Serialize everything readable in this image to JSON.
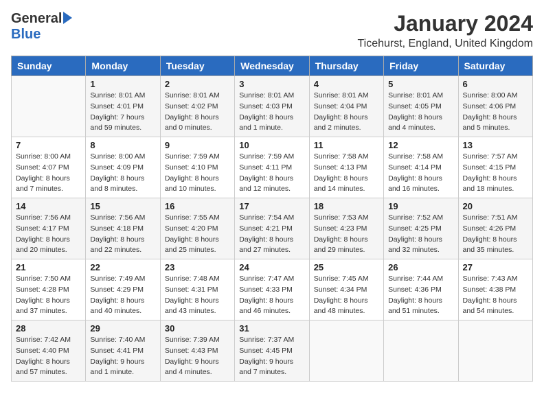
{
  "header": {
    "logo_general": "General",
    "logo_blue": "Blue",
    "month_title": "January 2024",
    "location": "Ticehurst, England, United Kingdom"
  },
  "days_of_week": [
    "Sunday",
    "Monday",
    "Tuesday",
    "Wednesday",
    "Thursday",
    "Friday",
    "Saturday"
  ],
  "weeks": [
    [
      {
        "day": "",
        "sunrise": "",
        "sunset": "",
        "daylight": ""
      },
      {
        "day": "1",
        "sunrise": "Sunrise: 8:01 AM",
        "sunset": "Sunset: 4:01 PM",
        "daylight": "Daylight: 7 hours and 59 minutes."
      },
      {
        "day": "2",
        "sunrise": "Sunrise: 8:01 AM",
        "sunset": "Sunset: 4:02 PM",
        "daylight": "Daylight: 8 hours and 0 minutes."
      },
      {
        "day": "3",
        "sunrise": "Sunrise: 8:01 AM",
        "sunset": "Sunset: 4:03 PM",
        "daylight": "Daylight: 8 hours and 1 minute."
      },
      {
        "day": "4",
        "sunrise": "Sunrise: 8:01 AM",
        "sunset": "Sunset: 4:04 PM",
        "daylight": "Daylight: 8 hours and 2 minutes."
      },
      {
        "day": "5",
        "sunrise": "Sunrise: 8:01 AM",
        "sunset": "Sunset: 4:05 PM",
        "daylight": "Daylight: 8 hours and 4 minutes."
      },
      {
        "day": "6",
        "sunrise": "Sunrise: 8:00 AM",
        "sunset": "Sunset: 4:06 PM",
        "daylight": "Daylight: 8 hours and 5 minutes."
      }
    ],
    [
      {
        "day": "7",
        "sunrise": "Sunrise: 8:00 AM",
        "sunset": "Sunset: 4:07 PM",
        "daylight": "Daylight: 8 hours and 7 minutes."
      },
      {
        "day": "8",
        "sunrise": "Sunrise: 8:00 AM",
        "sunset": "Sunset: 4:09 PM",
        "daylight": "Daylight: 8 hours and 8 minutes."
      },
      {
        "day": "9",
        "sunrise": "Sunrise: 7:59 AM",
        "sunset": "Sunset: 4:10 PM",
        "daylight": "Daylight: 8 hours and 10 minutes."
      },
      {
        "day": "10",
        "sunrise": "Sunrise: 7:59 AM",
        "sunset": "Sunset: 4:11 PM",
        "daylight": "Daylight: 8 hours and 12 minutes."
      },
      {
        "day": "11",
        "sunrise": "Sunrise: 7:58 AM",
        "sunset": "Sunset: 4:13 PM",
        "daylight": "Daylight: 8 hours and 14 minutes."
      },
      {
        "day": "12",
        "sunrise": "Sunrise: 7:58 AM",
        "sunset": "Sunset: 4:14 PM",
        "daylight": "Daylight: 8 hours and 16 minutes."
      },
      {
        "day": "13",
        "sunrise": "Sunrise: 7:57 AM",
        "sunset": "Sunset: 4:15 PM",
        "daylight": "Daylight: 8 hours and 18 minutes."
      }
    ],
    [
      {
        "day": "14",
        "sunrise": "Sunrise: 7:56 AM",
        "sunset": "Sunset: 4:17 PM",
        "daylight": "Daylight: 8 hours and 20 minutes."
      },
      {
        "day": "15",
        "sunrise": "Sunrise: 7:56 AM",
        "sunset": "Sunset: 4:18 PM",
        "daylight": "Daylight: 8 hours and 22 minutes."
      },
      {
        "day": "16",
        "sunrise": "Sunrise: 7:55 AM",
        "sunset": "Sunset: 4:20 PM",
        "daylight": "Daylight: 8 hours and 25 minutes."
      },
      {
        "day": "17",
        "sunrise": "Sunrise: 7:54 AM",
        "sunset": "Sunset: 4:21 PM",
        "daylight": "Daylight: 8 hours and 27 minutes."
      },
      {
        "day": "18",
        "sunrise": "Sunrise: 7:53 AM",
        "sunset": "Sunset: 4:23 PM",
        "daylight": "Daylight: 8 hours and 29 minutes."
      },
      {
        "day": "19",
        "sunrise": "Sunrise: 7:52 AM",
        "sunset": "Sunset: 4:25 PM",
        "daylight": "Daylight: 8 hours and 32 minutes."
      },
      {
        "day": "20",
        "sunrise": "Sunrise: 7:51 AM",
        "sunset": "Sunset: 4:26 PM",
        "daylight": "Daylight: 8 hours and 35 minutes."
      }
    ],
    [
      {
        "day": "21",
        "sunrise": "Sunrise: 7:50 AM",
        "sunset": "Sunset: 4:28 PM",
        "daylight": "Daylight: 8 hours and 37 minutes."
      },
      {
        "day": "22",
        "sunrise": "Sunrise: 7:49 AM",
        "sunset": "Sunset: 4:29 PM",
        "daylight": "Daylight: 8 hours and 40 minutes."
      },
      {
        "day": "23",
        "sunrise": "Sunrise: 7:48 AM",
        "sunset": "Sunset: 4:31 PM",
        "daylight": "Daylight: 8 hours and 43 minutes."
      },
      {
        "day": "24",
        "sunrise": "Sunrise: 7:47 AM",
        "sunset": "Sunset: 4:33 PM",
        "daylight": "Daylight: 8 hours and 46 minutes."
      },
      {
        "day": "25",
        "sunrise": "Sunrise: 7:45 AM",
        "sunset": "Sunset: 4:34 PM",
        "daylight": "Daylight: 8 hours and 48 minutes."
      },
      {
        "day": "26",
        "sunrise": "Sunrise: 7:44 AM",
        "sunset": "Sunset: 4:36 PM",
        "daylight": "Daylight: 8 hours and 51 minutes."
      },
      {
        "day": "27",
        "sunrise": "Sunrise: 7:43 AM",
        "sunset": "Sunset: 4:38 PM",
        "daylight": "Daylight: 8 hours and 54 minutes."
      }
    ],
    [
      {
        "day": "28",
        "sunrise": "Sunrise: 7:42 AM",
        "sunset": "Sunset: 4:40 PM",
        "daylight": "Daylight: 8 hours and 57 minutes."
      },
      {
        "day": "29",
        "sunrise": "Sunrise: 7:40 AM",
        "sunset": "Sunset: 4:41 PM",
        "daylight": "Daylight: 9 hours and 1 minute."
      },
      {
        "day": "30",
        "sunrise": "Sunrise: 7:39 AM",
        "sunset": "Sunset: 4:43 PM",
        "daylight": "Daylight: 9 hours and 4 minutes."
      },
      {
        "day": "31",
        "sunrise": "Sunrise: 7:37 AM",
        "sunset": "Sunset: 4:45 PM",
        "daylight": "Daylight: 9 hours and 7 minutes."
      },
      {
        "day": "",
        "sunrise": "",
        "sunset": "",
        "daylight": ""
      },
      {
        "day": "",
        "sunrise": "",
        "sunset": "",
        "daylight": ""
      },
      {
        "day": "",
        "sunrise": "",
        "sunset": "",
        "daylight": ""
      }
    ]
  ]
}
